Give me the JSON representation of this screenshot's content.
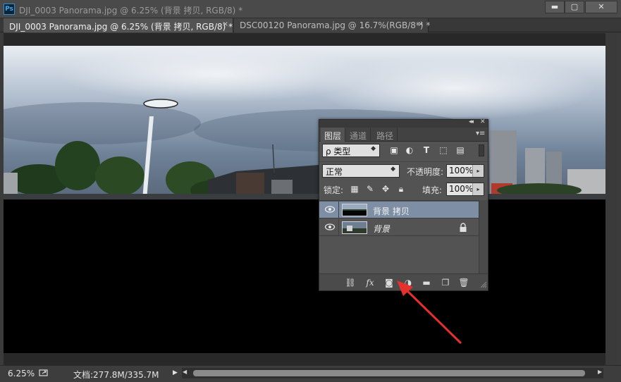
{
  "window": {
    "logo": "Ps",
    "title": "DJI_0003 Panorama.jpg @ 6.25% (背景 拷贝, RGB/8) *",
    "min_label": "▬",
    "max_label": "▢",
    "close_label": "✕"
  },
  "tabs": [
    {
      "label": "DJI_0003 Panorama.jpg @ 6.25% (背景 拷贝, RGB/8) *",
      "close": "×",
      "active": true
    },
    {
      "label": "DSC00120 Panorama.jpg @ 16.7%(RGB/8*) *",
      "close": "×",
      "active": false
    }
  ],
  "layers_panel": {
    "collapse": "◂◂",
    "close": "✕",
    "tabs": [
      "图层",
      "通道",
      "路径"
    ],
    "menu_icon": "▾≡",
    "kind_filter": "ρ 类型",
    "blend_mode": "正常",
    "opacity_label": "不透明度:",
    "opacity_value": "100%",
    "lock_label": "锁定:",
    "fill_label": "填充:",
    "fill_value": "100%",
    "layers": [
      {
        "name": "背景 拷贝",
        "selected": true,
        "locked": false
      },
      {
        "name": "背景",
        "selected": false,
        "locked": true
      }
    ],
    "footer_icons": [
      "link-layers-icon",
      "fx-icon",
      "add-mask-icon",
      "adjustment-layer-icon",
      "new-group-icon",
      "new-layer-icon",
      "delete-layer-icon"
    ]
  },
  "status": {
    "zoom": "6.25%",
    "doc_info": "文档:277.8M/335.7M",
    "arrow": "▶"
  },
  "colors": {
    "annotation_arrow": "#e5302b",
    "selected_layer": "#7d8ea5",
    "panel_bg": "#535353"
  }
}
